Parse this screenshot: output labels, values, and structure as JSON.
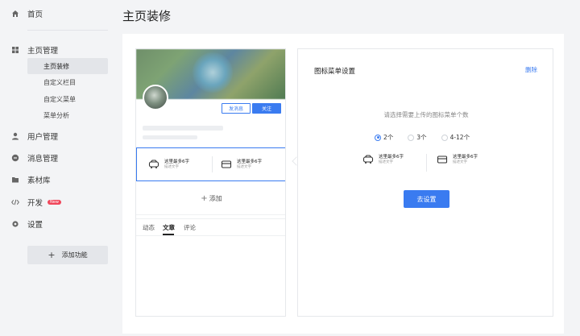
{
  "sidebar": {
    "home": "首页",
    "homepage_mgmt": "主页管理",
    "sub_items": [
      "主页装修",
      "自定义栏目",
      "自定义菜单",
      "菜单分析"
    ],
    "user_mgmt": "用户管理",
    "msg_mgmt": "消息管理",
    "material": "素材库",
    "develop": "开发",
    "develop_badge": "New",
    "settings": "设置",
    "add_func": "添加功能"
  },
  "page_title": "主页装修",
  "preview": {
    "btn_message": "发消息",
    "btn_follow": "关注",
    "menu_items": [
      {
        "title": "这里最多6字",
        "sub": "描述文字",
        "icon": "car-icon"
      },
      {
        "title": "这里最多6字",
        "sub": "描述文字",
        "icon": "card-icon"
      }
    ],
    "add_label": "添加",
    "tabs": [
      "动态",
      "文章",
      "评论"
    ],
    "active_tab": "文章"
  },
  "settings": {
    "title": "图标菜单设置",
    "delete": "删除",
    "prompt": "请选择需要上传的图标菜单个数",
    "options": [
      "2个",
      "3个",
      "4-12个"
    ],
    "selected_option": "2个",
    "preview_items": [
      {
        "title": "这里最多6字",
        "sub": "描述文字",
        "icon": "car-icon"
      },
      {
        "title": "这里最多6字",
        "sub": "描述文字",
        "icon": "card-icon"
      }
    ],
    "go_button": "去设置"
  },
  "colors": {
    "accent": "#3a7bf0",
    "badge": "#f0465a"
  }
}
